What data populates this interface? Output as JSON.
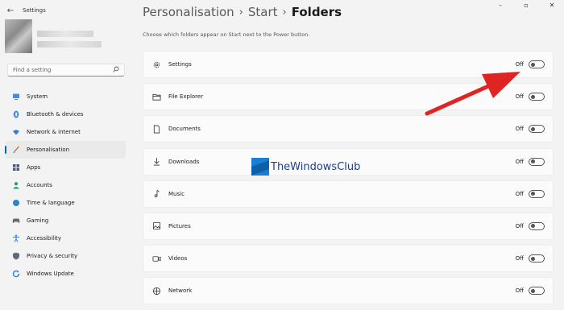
{
  "window": {
    "app_title": "Settings",
    "back_glyph": "←",
    "minimize_glyph": "–",
    "maximize_glyph": "▫",
    "close_glyph": "✕"
  },
  "sidebar": {
    "search": {
      "placeholder": "Find a setting",
      "value": ""
    },
    "items": [
      {
        "label": "System",
        "icon": "system-icon",
        "active": false
      },
      {
        "label": "Bluetooth & devices",
        "icon": "bluetooth-icon",
        "active": false
      },
      {
        "label": "Network & internet",
        "icon": "wifi-icon",
        "active": false
      },
      {
        "label": "Personalisation",
        "icon": "brush-icon",
        "active": true
      },
      {
        "label": "Apps",
        "icon": "apps-icon",
        "active": false
      },
      {
        "label": "Accounts",
        "icon": "accounts-icon",
        "active": false
      },
      {
        "label": "Time & language",
        "icon": "globe-icon",
        "active": false
      },
      {
        "label": "Gaming",
        "icon": "gamepad-icon",
        "active": false
      },
      {
        "label": "Accessibility",
        "icon": "accessibility-icon",
        "active": false
      },
      {
        "label": "Privacy & security",
        "icon": "shield-icon",
        "active": false
      },
      {
        "label": "Windows Update",
        "icon": "update-icon",
        "active": false
      }
    ]
  },
  "breadcrumb": {
    "items": [
      "Personalisation",
      "Start"
    ],
    "current": "Folders",
    "separator": "›"
  },
  "subtitle": "Choose which folders appear on Start next to the Power button.",
  "folders": [
    {
      "label": "Settings",
      "icon": "gear-icon",
      "state": "Off"
    },
    {
      "label": "File Explorer",
      "icon": "folder-icon",
      "state": "Off"
    },
    {
      "label": "Documents",
      "icon": "document-icon",
      "state": "Off"
    },
    {
      "label": "Downloads",
      "icon": "download-icon",
      "state": "Off"
    },
    {
      "label": "Music",
      "icon": "music-icon",
      "state": "Off"
    },
    {
      "label": "Pictures",
      "icon": "picture-icon",
      "state": "Off"
    },
    {
      "label": "Videos",
      "icon": "video-icon",
      "state": "Off"
    },
    {
      "label": "Network",
      "icon": "network-icon",
      "state": "Off"
    }
  ],
  "watermark": {
    "text": "TheWindowsClub"
  },
  "colors": {
    "accent": "#0067c0",
    "arrow": "#e02424",
    "watermark": "#1f3f8c"
  }
}
